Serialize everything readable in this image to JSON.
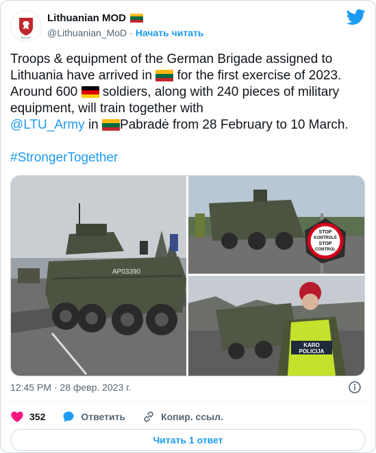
{
  "author": {
    "display_name": "Lithuanian MOD",
    "handle": "@Lithuanian_MoD",
    "follow_label": "Начать читать",
    "avatar_text": "MINISTRY OF NATIONAL DEFENCE REPUBLIC OF LITHUANIA"
  },
  "tweet": {
    "line1": "Troops & equipment of the German Brigade assigned to",
    "line2_a": "Lithuania have arrived in ",
    "line2_b": " for the first exercise of 2023.",
    "line3_a": "Around 600 ",
    "line3_b": " soldiers, along with 240 pieces of military",
    "line4": "equipment, will train together with",
    "mention": "@LTU_Army",
    "line5_a": " in ",
    "line5_b": "Pabradė from 28 February to 10 March.",
    "hashtag": "#StrongerTogether"
  },
  "photos": {
    "vehicle_plate": "AP03390",
    "stop_sign_line1": "STOP",
    "stop_sign_line2": "KONTROLĖ",
    "stop_sign_line3": "STOP",
    "stop_sign_line4": "CONTROL",
    "vest_text_1": "KARO",
    "vest_text_2": "POLICIJA"
  },
  "meta": {
    "timestamp": "12:45 PM · 28 февр. 2023 г."
  },
  "actions": {
    "likes": "352",
    "reply_label": "Ответить",
    "copy_link_label": "Копир. ссыл."
  },
  "read_replies_label": "Читать 1 ответ",
  "icons": {
    "twitter": "twitter-bird-icon",
    "like": "heart-icon",
    "reply": "speech-bubble-icon",
    "copy": "link-icon",
    "info": "info-icon"
  },
  "colors": {
    "accent": "#1d9bf0",
    "like": "#f91880",
    "lithuania_flag": [
      "#fdb913",
      "#006a44",
      "#c1272d"
    ],
    "germany_flag": [
      "#000000",
      "#dd0000",
      "#ffce00"
    ]
  }
}
